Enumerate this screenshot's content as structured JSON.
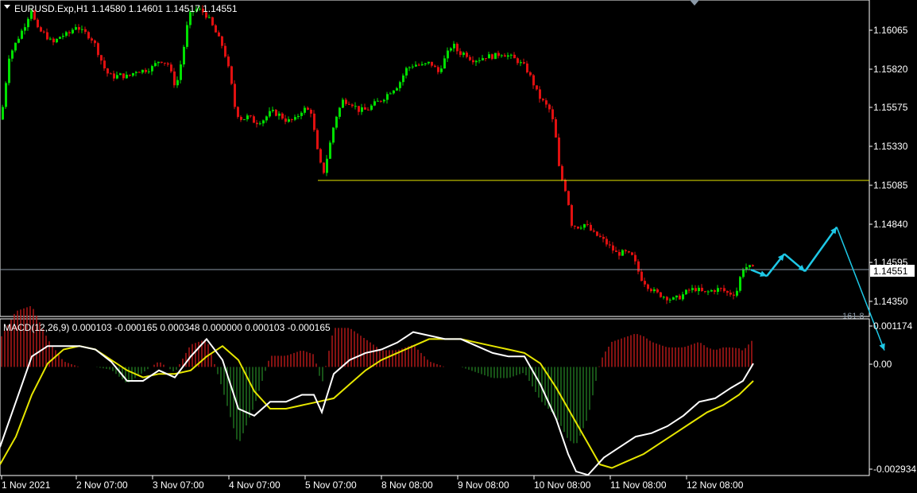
{
  "header": {
    "symbol": "EURUSD.Exp,H1",
    "ohlc": "1.14580 1.14601 1.14517 1.14551"
  },
  "price_axis": {
    "ticks": [
      "1.16065",
      "1.15820",
      "1.15575",
      "1.15330",
      "1.15085",
      "1.14840",
      "1.14595",
      "1.14350"
    ],
    "current_price": "1.14551",
    "fib_label": "161.8"
  },
  "macd": {
    "label": "MACD(12,26,9) 0.000103 -0.000165 0.000348 0.000000 0.000103 -0.000165",
    "ticks": [
      "0.001174",
      "0.00",
      "-0.002934"
    ]
  },
  "time_axis": {
    "labels": [
      "1 Nov 2021",
      "2 Nov 07:00",
      "3 Nov 07:00",
      "4 Nov 07:00",
      "5 Nov 07:00",
      "8 Nov 08:00",
      "9 Nov 08:00",
      "10 Nov 08:00",
      "11 Nov 08:00",
      "12 Nov 08:00"
    ]
  },
  "chart_data": [
    {
      "type": "candlestick",
      "symbol": "EURUSD.Exp",
      "timeframe": "H1",
      "ylim": [
        1.1425,
        1.163
      ],
      "path": [
        [
          0,
          1.155
        ],
        [
          5,
          1.157
        ],
        [
          10,
          1.159
        ],
        [
          20,
          1.16
        ],
        [
          30,
          1.161
        ],
        [
          38,
          1.162
        ],
        [
          45,
          1.1607
        ],
        [
          55,
          1.1604
        ],
        [
          65,
          1.1598
        ],
        [
          75,
          1.1603
        ],
        [
          85,
          1.1604
        ],
        [
          95,
          1.161
        ],
        [
          100,
          1.1606
        ],
        [
          108,
          1.1604
        ],
        [
          116,
          1.16
        ],
        [
          124,
          1.159
        ],
        [
          132,
          1.158
        ],
        [
          140,
          1.1577
        ],
        [
          150,
          1.1578
        ],
        [
          160,
          1.1577
        ],
        [
          170,
          1.1581
        ],
        [
          180,
          1.1581
        ],
        [
          190,
          1.1583
        ],
        [
          200,
          1.1588
        ],
        [
          210,
          1.1585
        ],
        [
          220,
          1.157
        ],
        [
          228,
          1.159
        ],
        [
          236,
          1.1615
        ],
        [
          244,
          1.162
        ],
        [
          252,
          1.1619
        ],
        [
          260,
          1.1615
        ],
        [
          270,
          1.1605
        ],
        [
          280,
          1.1595
        ],
        [
          288,
          1.1578
        ],
        [
          295,
          1.1555
        ],
        [
          303,
          1.155
        ],
        [
          311,
          1.1552
        ],
        [
          320,
          1.1548
        ],
        [
          330,
          1.155
        ],
        [
          340,
          1.1555
        ],
        [
          350,
          1.1553
        ],
        [
          360,
          1.1549
        ],
        [
          370,
          1.155
        ],
        [
          380,
          1.1557
        ],
        [
          390,
          1.1555
        ],
        [
          398,
          1.153
        ],
        [
          405,
          1.1515
        ],
        [
          412,
          1.153
        ],
        [
          420,
          1.155
        ],
        [
          430,
          1.1562
        ],
        [
          440,
          1.1561
        ],
        [
          450,
          1.1556
        ],
        [
          460,
          1.1556
        ],
        [
          470,
          1.156
        ],
        [
          480,
          1.1563
        ],
        [
          490,
          1.1568
        ],
        [
          500,
          1.1572
        ],
        [
          510,
          1.1582
        ],
        [
          520,
          1.1585
        ],
        [
          530,
          1.1584
        ],
        [
          540,
          1.1586
        ],
        [
          550,
          1.158
        ],
        [
          560,
          1.159
        ],
        [
          568,
          1.1598
        ],
        [
          576,
          1.1592
        ],
        [
          584,
          1.1592
        ],
        [
          592,
          1.1588
        ],
        [
          600,
          1.1588
        ],
        [
          610,
          1.159
        ],
        [
          620,
          1.159
        ],
        [
          630,
          1.1592
        ],
        [
          640,
          1.159
        ],
        [
          650,
          1.1587
        ],
        [
          660,
          1.1583
        ],
        [
          668,
          1.1575
        ],
        [
          676,
          1.1565
        ],
        [
          684,
          1.156
        ],
        [
          692,
          1.1555
        ],
        [
          698,
          1.1538
        ],
        [
          703,
          1.1515
        ],
        [
          708,
          1.151
        ],
        [
          713,
          1.15
        ],
        [
          718,
          1.1484
        ],
        [
          725,
          1.1482
        ],
        [
          735,
          1.1484
        ],
        [
          745,
          1.1478
        ],
        [
          755,
          1.1475
        ],
        [
          765,
          1.147
        ],
        [
          775,
          1.1465
        ],
        [
          785,
          1.1466
        ],
        [
          795,
          1.1463
        ],
        [
          805,
          1.145
        ],
        [
          815,
          1.1444
        ],
        [
          825,
          1.144
        ],
        [
          835,
          1.1438
        ],
        [
          845,
          1.1436
        ],
        [
          855,
          1.1438
        ],
        [
          865,
          1.1442
        ],
        [
          875,
          1.1443
        ],
        [
          885,
          1.144
        ],
        [
          895,
          1.1442
        ],
        [
          905,
          1.1443
        ],
        [
          915,
          1.144
        ],
        [
          925,
          1.144
        ],
        [
          933,
          1.1456
        ],
        [
          940,
          1.1457
        ],
        [
          948,
          1.1455
        ]
      ],
      "horizontal_lines": [
        {
          "price": 1.15115,
          "x_start": 400,
          "color": "#e6e600"
        },
        {
          "price": 1.14551,
          "x_start": 0,
          "color": "#8c9aa8"
        }
      ],
      "projection_arrows": [
        [
          945,
          1.1455
        ],
        [
          965,
          1.1451
        ],
        [
          987,
          1.1465
        ],
        [
          1013,
          1.1454
        ],
        [
          1053,
          1.1482
        ],
        [
          1113,
          1.1404
        ]
      ],
      "colors": {
        "bull": "#00e000",
        "bear": "#e01010",
        "arrow": "#1ec8e6"
      }
    },
    {
      "type": "line",
      "title": "MACD(12,26,9)",
      "ylim": [
        -0.002934,
        0.001174
      ],
      "macd_line": [
        [
          0,
          -0.0023
        ],
        [
          20,
          -0.001
        ],
        [
          40,
          0.0003
        ],
        [
          60,
          0.0006
        ],
        [
          80,
          0.0006
        ],
        [
          100,
          0.0006
        ],
        [
          120,
          0.0005
        ],
        [
          140,
          0.00015
        ],
        [
          160,
          -0.0004
        ],
        [
          180,
          -0.0004
        ],
        [
          200,
          -0.0001
        ],
        [
          220,
          -0.0003
        ],
        [
          240,
          0.0003
        ],
        [
          260,
          0.0008
        ],
        [
          280,
          0.0002
        ],
        [
          300,
          -0.0012
        ],
        [
          320,
          -0.0014
        ],
        [
          340,
          -0.001
        ],
        [
          360,
          -0.001
        ],
        [
          380,
          -0.0008
        ],
        [
          395,
          -0.0008
        ],
        [
          405,
          -0.0013
        ],
        [
          420,
          -0.0002
        ],
        [
          440,
          0.0002
        ],
        [
          460,
          0.0004
        ],
        [
          480,
          0.0005
        ],
        [
          500,
          0.0007
        ],
        [
          520,
          0.001
        ],
        [
          540,
          0.0009
        ],
        [
          560,
          0.0008
        ],
        [
          580,
          0.0008
        ],
        [
          600,
          0.0006
        ],
        [
          620,
          0.0004
        ],
        [
          640,
          0.0003
        ],
        [
          660,
          0.0003
        ],
        [
          680,
          -0.0005
        ],
        [
          700,
          -0.0015
        ],
        [
          715,
          -0.0025
        ],
        [
          725,
          -0.003
        ],
        [
          740,
          -0.0031
        ],
        [
          760,
          -0.0026
        ],
        [
          780,
          -0.0023
        ],
        [
          800,
          -0.002
        ],
        [
          820,
          -0.0019
        ],
        [
          840,
          -0.0017
        ],
        [
          860,
          -0.0014
        ],
        [
          880,
          -0.001
        ],
        [
          900,
          -0.0009
        ],
        [
          920,
          -0.0006
        ],
        [
          935,
          -0.0004
        ],
        [
          948,
          0.0001
        ]
      ],
      "signal_line": [
        [
          0,
          -0.0028
        ],
        [
          20,
          -0.002
        ],
        [
          40,
          -0.0008
        ],
        [
          60,
          0.0001
        ],
        [
          80,
          0.0005
        ],
        [
          100,
          0.0006
        ],
        [
          120,
          0.0005
        ],
        [
          140,
          0.0002
        ],
        [
          160,
          -0.0001
        ],
        [
          180,
          -0.0003
        ],
        [
          200,
          -0.0002
        ],
        [
          220,
          -0.0002
        ],
        [
          240,
          -0.0001
        ],
        [
          260,
          0.0003
        ],
        [
          280,
          0.0006
        ],
        [
          300,
          0.0002
        ],
        [
          320,
          -0.0007
        ],
        [
          340,
          -0.0012
        ],
        [
          360,
          -0.0012
        ],
        [
          380,
          -0.0011
        ],
        [
          400,
          -0.001
        ],
        [
          420,
          -0.0009
        ],
        [
          440,
          -0.0005
        ],
        [
          460,
          -0.0001
        ],
        [
          480,
          0.0002
        ],
        [
          500,
          0.0004
        ],
        [
          520,
          0.0006
        ],
        [
          540,
          0.0008
        ],
        [
          560,
          0.0008
        ],
        [
          580,
          0.0008
        ],
        [
          600,
          0.0007
        ],
        [
          620,
          0.0006
        ],
        [
          640,
          0.0005
        ],
        [
          660,
          0.0004
        ],
        [
          680,
          0.0001
        ],
        [
          700,
          -0.0006
        ],
        [
          720,
          -0.0014
        ],
        [
          740,
          -0.0022
        ],
        [
          755,
          -0.0028
        ],
        [
          770,
          -0.0029
        ],
        [
          790,
          -0.0027
        ],
        [
          810,
          -0.0025
        ],
        [
          830,
          -0.0022
        ],
        [
          850,
          -0.0019
        ],
        [
          870,
          -0.0016
        ],
        [
          890,
          -0.0013
        ],
        [
          910,
          -0.0011
        ],
        [
          930,
          -0.0008
        ],
        [
          948,
          -0.0004
        ]
      ],
      "colors": {
        "macd": "#ffffff",
        "signal": "#e6e600",
        "hist_pos": "#b01818",
        "hist_neg": "#1f6f1f"
      }
    }
  ]
}
